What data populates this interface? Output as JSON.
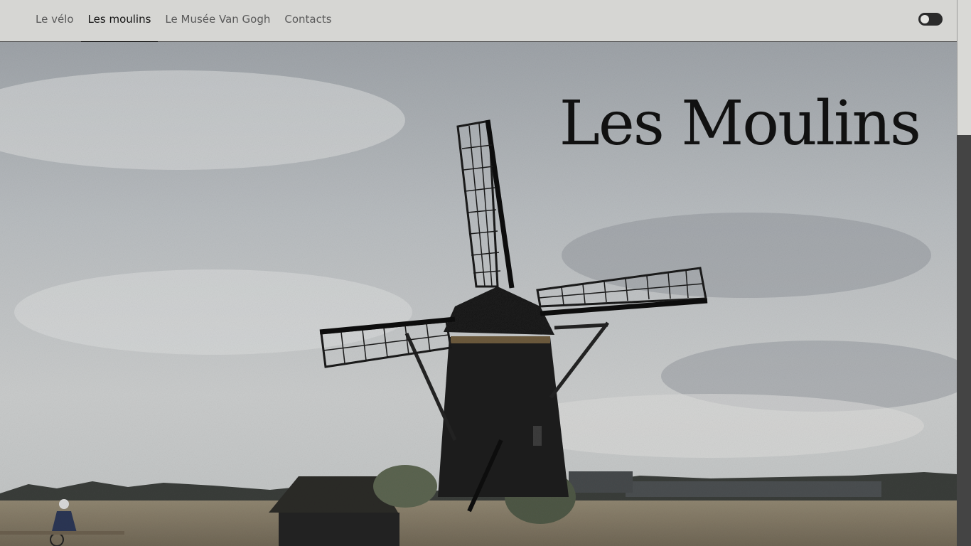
{
  "nav": {
    "items": [
      {
        "label": "Le vélo",
        "active": false
      },
      {
        "label": "Les moulins",
        "active": true
      },
      {
        "label": "Le Musée Van Gogh",
        "active": false
      },
      {
        "label": "Contacts",
        "active": false
      }
    ],
    "theme_toggle_icon": "toggle-switch-icon"
  },
  "hero": {
    "title": "Les Moulins",
    "image_subject": "windmill-photo"
  },
  "colors": {
    "nav_background": "#d6d6d3",
    "nav_text": "#5a5a5a",
    "nav_active": "#111111",
    "title": "#111111",
    "sky": "#b9bcbf",
    "windmill": "#1e1e1e"
  }
}
